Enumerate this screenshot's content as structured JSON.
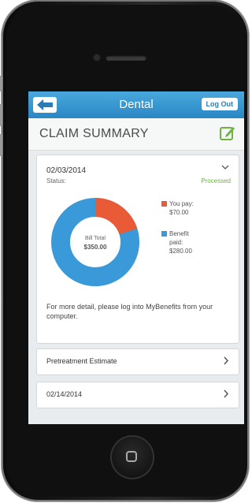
{
  "nav": {
    "title": "Dental",
    "logout_label": "Log Out"
  },
  "page": {
    "title": "CLAIM SUMMARY"
  },
  "claim": {
    "date": "02/03/2014",
    "status_label": "Status:",
    "status_value": "Processed",
    "bill_total_label": "Bill Total",
    "bill_total_value": "$350.00",
    "you_pay_label": "You pay:",
    "you_pay_value": "$70.00",
    "benefit_label_1": "Benefit",
    "benefit_label_2": "paid:",
    "benefit_value": "$280.00",
    "you_pay_fraction": 0.2,
    "note": "For more detail, please log into MyBenefits from your computer."
  },
  "list": [
    {
      "label": "Pretreatment Estimate"
    },
    {
      "label": "02/14/2014"
    }
  ],
  "colors": {
    "you_pay": "#e85b36",
    "benefit": "#3a9ad9",
    "accent": "#2b87c3",
    "processed": "#6cb33f"
  },
  "icons": {
    "back": "back-arrow-icon",
    "edit": "edit-icon",
    "expand": "chevron-down-icon",
    "row": "chevron-right-icon"
  }
}
